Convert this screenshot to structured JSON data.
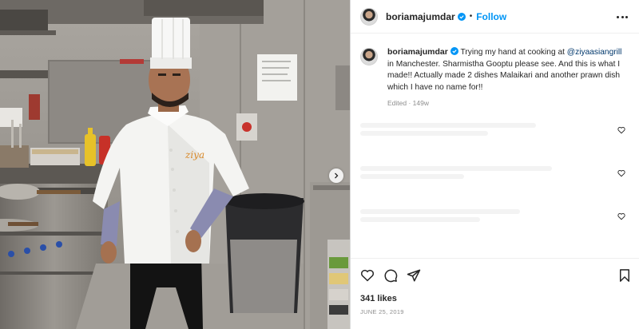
{
  "post": {
    "username": "boriamajumdar",
    "follow_label": "Follow",
    "separator": "•",
    "caption": {
      "text_before": "Trying my hand at cooking at ",
      "mention": "@ziyaasiangrill",
      "text_after": " in Manchester. Sharmistha Gooptu please see. And this is what I made!! Actually made 2 dishes Malaikari and another prawn dish which I have no name for!!"
    },
    "edited": "Edited · 149w",
    "likes": "341 likes",
    "date": "JUNE 25, 2019"
  },
  "photo": {
    "jacket_logo": "ziya"
  },
  "icons": {
    "verified": "verified-badge-icon",
    "more": "more-options-icon",
    "like": "heart-icon",
    "comment": "comment-icon",
    "share": "paper-plane-icon",
    "save": "bookmark-icon",
    "next": "chevron-right-icon"
  },
  "colors": {
    "follow": "#0095f6",
    "mention": "#00376b",
    "secondary": "#8e8e8e",
    "text": "#262626",
    "jacket_logo": "#d98a2b"
  }
}
